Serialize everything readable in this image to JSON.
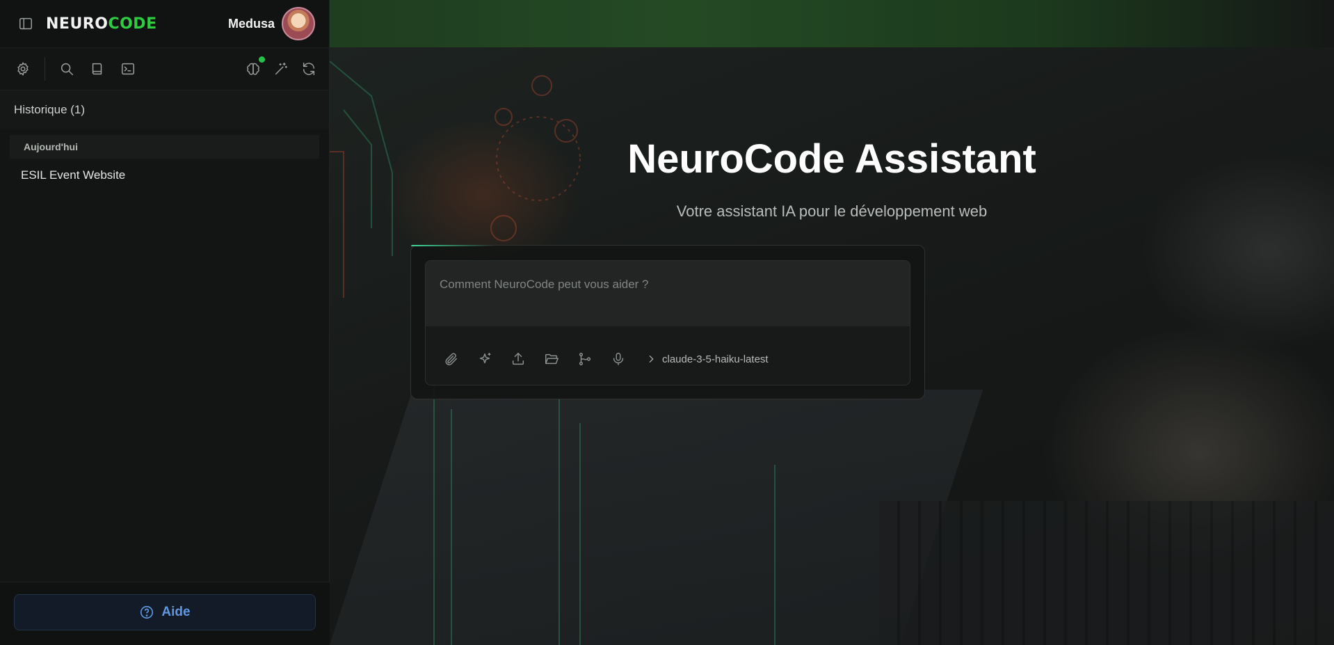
{
  "app": {
    "brand_part1": "NEURO",
    "brand_part2": "CODE",
    "brand_color": "#2ecc40"
  },
  "user": {
    "name": "Medusa"
  },
  "toolbar": {
    "left_icons": [
      "settings-icon",
      "search-icon",
      "book-icon",
      "terminal-icon"
    ],
    "right_icons": [
      "brain-icon",
      "magic-wand-icon",
      "refresh-icon"
    ],
    "status_color": "#27c24c"
  },
  "history": {
    "title": "Historique (1)",
    "groups": [
      {
        "label": "Aujourd'hui",
        "items": [
          {
            "label": "ESIL Event Website"
          }
        ]
      }
    ]
  },
  "footer": {
    "help_label": "Aide",
    "help_color": "#5f97e0"
  },
  "hero": {
    "title": "NeuroCode Assistant",
    "subtitle": "Votre assistant IA pour le développement web"
  },
  "chat": {
    "placeholder": "Comment NeuroCode peut vous aider ?",
    "value": "",
    "tool_icons": [
      "paperclip-icon",
      "sparkles-icon",
      "upload-icon",
      "folder-open-icon",
      "git-branch-icon",
      "microphone-icon"
    ],
    "model": "claude-3-5-haiku-latest"
  }
}
